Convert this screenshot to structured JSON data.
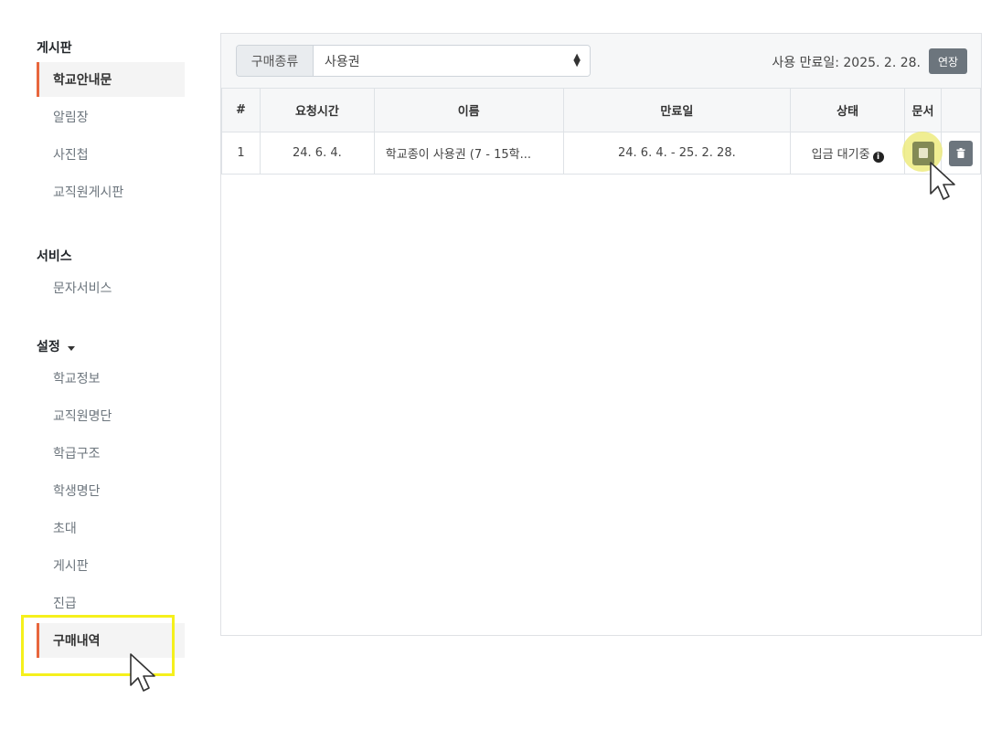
{
  "sidebar": {
    "board_title": "게시판",
    "board_items": [
      "학교안내문",
      "알림장",
      "사진첩",
      "교직원게시판"
    ],
    "service_title": "서비스",
    "service_items": [
      "문자서비스"
    ],
    "settings_title": "설정",
    "settings_items": [
      "학교정보",
      "교직원명단",
      "학급구조",
      "학생명단",
      "초대",
      "게시판",
      "진급",
      "구매내역"
    ]
  },
  "filter": {
    "label": "구매종류",
    "selected": "사용권"
  },
  "expiry_text": "사용 만료일: 2025. 2. 28.",
  "extend_label": "연장",
  "table": {
    "headers": [
      "#",
      "요청시간",
      "이름",
      "만료일",
      "상태",
      "문서",
      ""
    ],
    "rows": [
      {
        "no": "1",
        "requested": "24. 6. 4.",
        "name": "학교종이 사용권 (7 - 15학...",
        "expires": "24. 6. 4. - 25. 2. 28.",
        "status": "입금 대기중"
      }
    ]
  },
  "icons": {
    "info": "info-circle-icon",
    "document": "document-icon",
    "delete": "trash-icon",
    "cursor": "mouse-pointer-icon",
    "caret": "caret-down-icon",
    "select_arrows": "sort-arrows-icon"
  },
  "colors": {
    "active_accent": "#e8663d",
    "highlight": "#f5f01c",
    "button_gray": "#6c757d",
    "doc_button": "#838a55"
  }
}
